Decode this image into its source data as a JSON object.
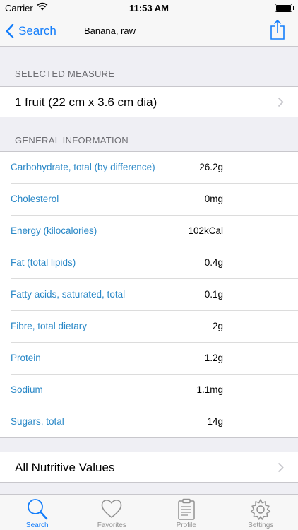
{
  "status": {
    "carrier": "Carrier",
    "time": "11:53 AM"
  },
  "nav": {
    "back_label": "Search",
    "title": "Banana, raw"
  },
  "selected_measure": {
    "header": "SELECTED MEASURE",
    "value": "1 fruit (22 cm x 3.6 cm dia)"
  },
  "general_information": {
    "header": "GENERAL INFORMATION",
    "rows": [
      {
        "name": "Carbohydrate, total (by difference)",
        "value": "26.2g"
      },
      {
        "name": "Cholesterol",
        "value": "0mg"
      },
      {
        "name": "Energy (kilocalories)",
        "value": "102kCal"
      },
      {
        "name": "Fat (total lipids)",
        "value": "0.4g"
      },
      {
        "name": "Fatty acids, saturated, total",
        "value": "0.1g"
      },
      {
        "name": "Fibre, total dietary",
        "value": "2g"
      },
      {
        "name": "Protein",
        "value": "1.2g"
      },
      {
        "name": "Sodium",
        "value": "1.1mg"
      },
      {
        "name": "Sugars, total",
        "value": "14g"
      }
    ]
  },
  "all_nutritive": {
    "label": "All Nutritive Values"
  },
  "tabs": [
    {
      "label": "Search",
      "icon": "search-icon",
      "active": true
    },
    {
      "label": "Favorites",
      "icon": "heart-icon",
      "active": false
    },
    {
      "label": "Profile",
      "icon": "clipboard-icon",
      "active": false
    },
    {
      "label": "Settings",
      "icon": "gear-icon",
      "active": false
    }
  ],
  "colors": {
    "accent": "#147efb",
    "link": "#2a88c7",
    "inactive_tab": "#929292"
  }
}
